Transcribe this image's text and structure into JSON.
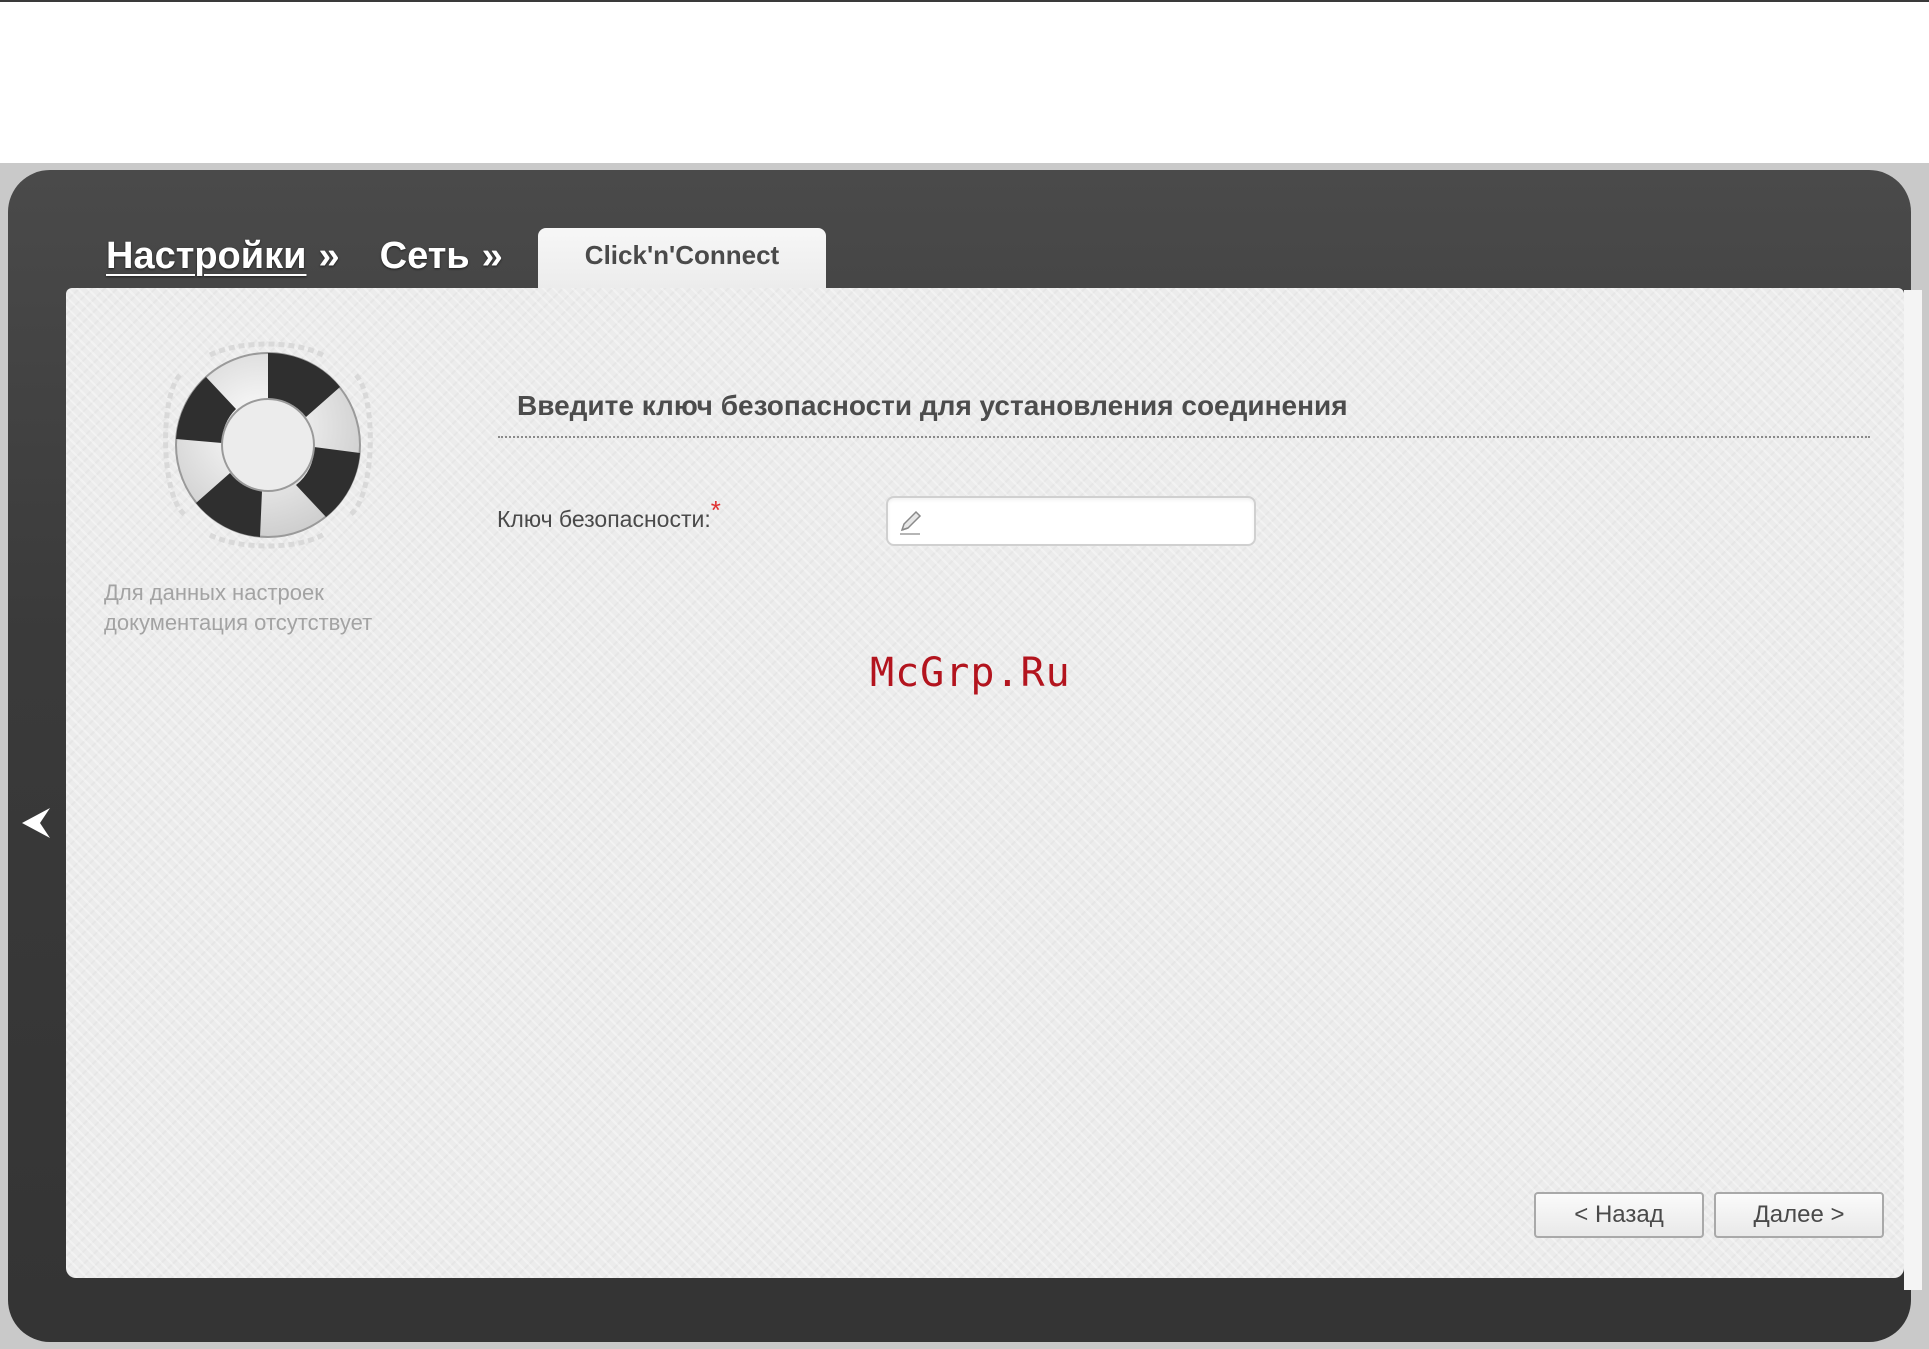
{
  "breadcrumb": {
    "items": [
      {
        "label": "Настройки",
        "sep": "»"
      },
      {
        "label": "Сеть",
        "sep": "»"
      }
    ],
    "active_tab": "Click'n'Connect"
  },
  "sidebar": {
    "icon": "lifebuoy-icon",
    "doc_note_line1": "Для данных настроек",
    "doc_note_line2": "документация отсутствует"
  },
  "main": {
    "section_title": "Введите ключ безопасности для установления соединения",
    "security_key": {
      "label": "Ключ безопасности:",
      "required_mark": "*",
      "value": "",
      "icon": "pencil-icon"
    }
  },
  "watermark": "McGrp.Ru",
  "buttons": {
    "back": "< Назад",
    "next": "Далее >"
  },
  "colors": {
    "frame": "#3a3a3a",
    "panel": "#ececec",
    "required": "#e03030",
    "watermark": "#b3141e"
  }
}
